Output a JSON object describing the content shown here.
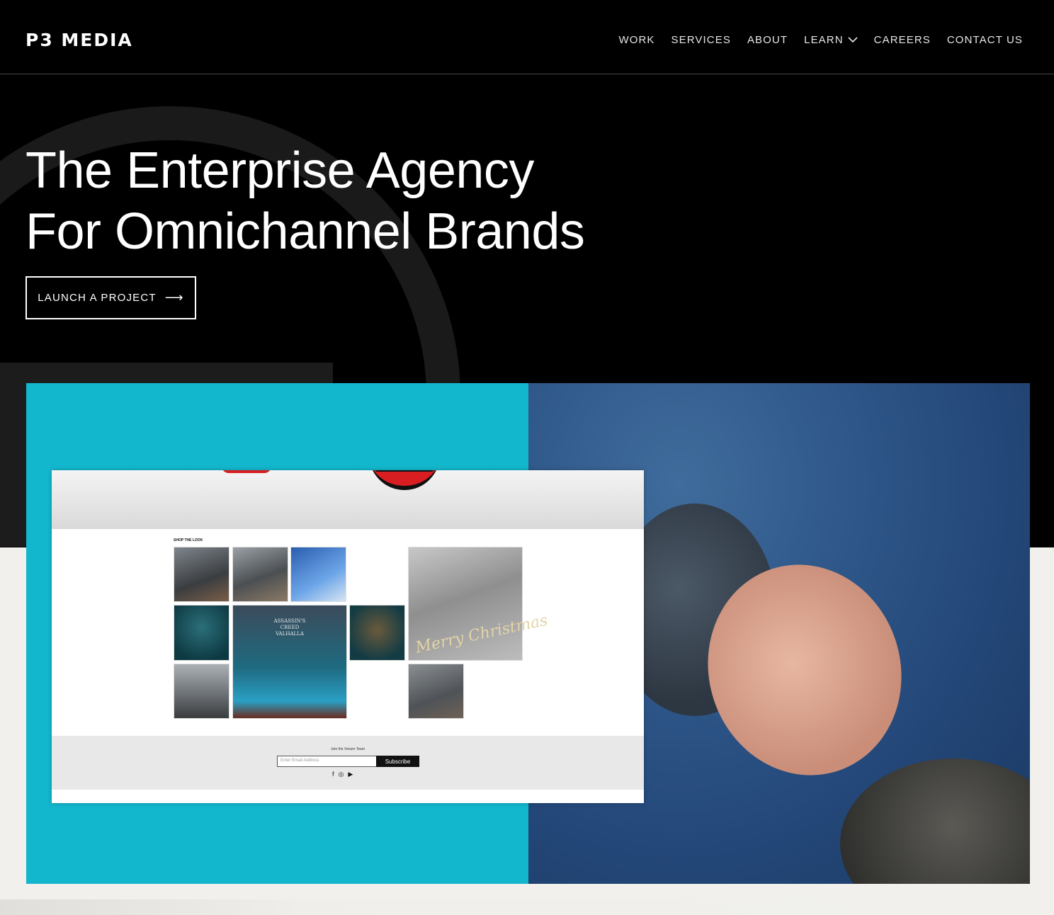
{
  "header": {
    "logo": "P3 MEDIA",
    "nav": [
      "WORK",
      "SERVICES",
      "ABOUT",
      "LEARN",
      "CAREERS",
      "CONTACT US"
    ]
  },
  "hero": {
    "headline_line1": "The Enterprise Agency",
    "headline_line2": "For Omnichannel Brands",
    "cta_label": "LAUNCH A PROJECT",
    "cta_arrow": "⟶"
  },
  "mockup": {
    "shop_label": "SHOP THE LOOK",
    "tile_text_1": "ASSASSIN'S CREED VALHALLA",
    "tile_text_2": "Merry Christmas",
    "join_text": "Join the Venum Team",
    "email_placeholder": "Enter Email Address",
    "subscribe_label": "Subscribe"
  },
  "colors": {
    "hero_bg": "#000000",
    "teal_panel": "#13b7cd",
    "page_bg": "#f1f0ec"
  }
}
